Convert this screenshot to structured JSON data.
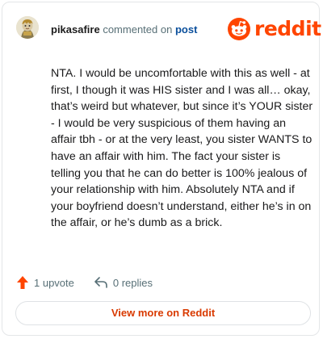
{
  "header": {
    "username": "pikasafire",
    "commented_text": "commented on",
    "post_link": "post"
  },
  "logo": {
    "text": "reddit",
    "brand_color": "#ff4500"
  },
  "comment": {
    "text": "NTA. I would be uncomfortable with this as well - at first, I though it was HIS sister and I was all… okay, that’s weird but whatever, but since it’s YOUR sister - I would be very suspicious of them having an affair tbh - or at the very least, you sister WANTS to have an affair with him. The fact your sister is telling you that he can do better is 100% jealous of your relationship with him. Absolutely NTA and if your boyfriend doesn’t understand, either he’s in on the affair, or he’s dumb as a brick."
  },
  "footer": {
    "upvotes": "1 upvote",
    "replies": "0 replies",
    "upvote_icon": "upvote-arrow-icon",
    "reply_icon": "reply-arrow-icon"
  },
  "cta": {
    "label": "View more on Reddit"
  }
}
